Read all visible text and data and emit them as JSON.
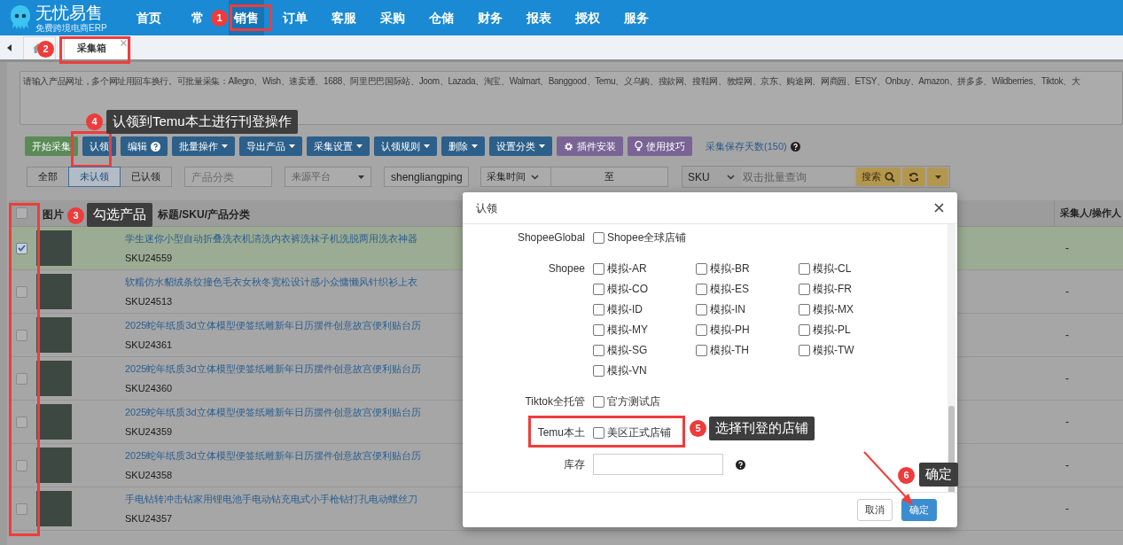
{
  "app": {
    "name": "无忧易售",
    "tagline": "免费跨境电商ERP"
  },
  "nav": [
    {
      "label": "首页",
      "selected": false
    },
    {
      "label": "常",
      "selected": false
    },
    {
      "label": "销售",
      "selected": true
    },
    {
      "label": "订单",
      "selected": false
    },
    {
      "label": "客服",
      "selected": false
    },
    {
      "label": "采购",
      "selected": false
    },
    {
      "label": "仓储",
      "selected": false
    },
    {
      "label": "财务",
      "selected": false
    },
    {
      "label": "报表",
      "selected": false
    },
    {
      "label": "授权",
      "selected": false
    },
    {
      "label": "服务",
      "selected": false
    }
  ],
  "tabs": [
    {
      "kind": "home",
      "selected": false
    },
    {
      "kind": "page",
      "label": "采集箱",
      "selected": true
    }
  ],
  "collect_input": {
    "placeholder": "请输入产品网址，多个网址用回车换行。可批量采集：Allegro、Wish、速卖通、1688、阿里巴巴国际站、Joom、Lazada、淘宝、Walmart、Banggood、Temu、义乌购、搜款网、搜鞋网、敦煌网、京东、购途网、网商园、ETSY、Onbuy、Amazon、拼多多、Wildberries、Tiktok、大"
  },
  "toolbar": [
    {
      "label": "开始采集",
      "kind": "success",
      "caret": false
    },
    {
      "label": "认领",
      "kind": "primary",
      "caret": false
    },
    {
      "label": "编辑",
      "kind": "help",
      "caret": false
    },
    {
      "label": "批量操作",
      "kind": "primary",
      "caret": true
    },
    {
      "label": "导出产品",
      "kind": "primary",
      "caret": true
    },
    {
      "label": "采集设置",
      "kind": "primary",
      "caret": true
    },
    {
      "label": "认领规则",
      "kind": "primary",
      "caret": true
    },
    {
      "label": "删除",
      "kind": "primary",
      "caret": true
    },
    {
      "label": "设置分类",
      "kind": "primary",
      "caret": true
    },
    {
      "label": "插件安装",
      "kind": "plugin",
      "caret": false
    },
    {
      "label": "使用技巧",
      "kind": "tips",
      "caret": false
    }
  ],
  "save_days": {
    "label": "采集保存天数(150)"
  },
  "filters": {
    "status_tabs": [
      {
        "label": "全部",
        "selected": false
      },
      {
        "label": "未认领",
        "selected": true
      },
      {
        "label": "已认领",
        "selected": false
      }
    ],
    "category": {
      "placeholder": "产品分类"
    },
    "source": {
      "placeholder": "来源平台"
    },
    "keyword": {
      "value": "shengliangping"
    },
    "time": {
      "value": "采集时间"
    },
    "range_separator": "至",
    "search_by": {
      "value": "SKU"
    },
    "search_input": {
      "placeholder": "双击批量查询"
    },
    "search_button": "搜索"
  },
  "table": {
    "select_all": {
      "checked": false
    },
    "columns": [
      "图片",
      "标题/SKU/产品分类",
      "采集人/操作人"
    ],
    "rows": [
      {
        "title": "学生迷你小型自动折叠洗衣机清洗内衣裤洗袜子机洗脱两用洗衣神器",
        "sku": "SKU24559",
        "collector": "-",
        "checked": true,
        "selected": true
      },
      {
        "title": "软糯仿水貂绒条纹撞色毛衣女秋冬宽松设计感小众慵懒风针织衫上衣",
        "sku": "SKU24513",
        "collector": "-",
        "checked": false,
        "selected": false
      },
      {
        "title": "2025蛇年纸质3d立体模型便签纸雕新年日历摆件创意故宫便利贴台历",
        "sku": "SKU24361",
        "collector": "-",
        "checked": false,
        "selected": false
      },
      {
        "title": "2025蛇年纸质3d立体模型便签纸雕新年日历摆件创意故宫便利贴台历",
        "sku": "SKU24360",
        "collector": "-",
        "checked": false,
        "selected": false
      },
      {
        "title": "2025蛇年纸质3d立体模型便签纸雕新年日历摆件创意故宫便利贴台历",
        "sku": "SKU24359",
        "collector": "-",
        "checked": false,
        "selected": false
      },
      {
        "title": "2025蛇年纸质3d立体模型便签纸雕新年日历摆件创意故宫便利贴台历",
        "sku": "SKU24358",
        "collector": "-",
        "checked": false,
        "selected": false
      },
      {
        "title": "手电钻转冲击钻家用锂电池手电动钻充电式小手枪钻打孔电动螺丝刀",
        "sku": "SKU24357",
        "collector": "-",
        "checked": false,
        "selected": false
      }
    ]
  },
  "dialog": {
    "title": "认领",
    "fields": [
      {
        "kind": "checks",
        "label": "ShopeeGlobal",
        "options": [
          {
            "label": "Shopee全球店铺",
            "checked": false
          }
        ]
      },
      {
        "kind": "checks",
        "label": "Shopee",
        "options": [
          {
            "label": "模拟-AR",
            "checked": false
          },
          {
            "label": "模拟-BR",
            "checked": false
          },
          {
            "label": "模拟-CL",
            "checked": false
          },
          {
            "label": "模拟-CO",
            "checked": false
          },
          {
            "label": "模拟-ES",
            "checked": false
          },
          {
            "label": "模拟-FR",
            "checked": false
          },
          {
            "label": "模拟-ID",
            "checked": false
          },
          {
            "label": "模拟-IN",
            "checked": false
          },
          {
            "label": "模拟-MX",
            "checked": false
          },
          {
            "label": "模拟-MY",
            "checked": false
          },
          {
            "label": "模拟-PH",
            "checked": false
          },
          {
            "label": "模拟-PL",
            "checked": false
          },
          {
            "label": "模拟-SG",
            "checked": false
          },
          {
            "label": "模拟-TH",
            "checked": false
          },
          {
            "label": "模拟-TW",
            "checked": false
          },
          {
            "label": "模拟-VN",
            "checked": false
          }
        ]
      },
      {
        "kind": "checks",
        "label": "Tiktok全托管",
        "options": [
          {
            "label": "官方测试店",
            "checked": false
          }
        ]
      },
      {
        "kind": "checks",
        "label": "Temu本土",
        "options": [
          {
            "label": "美区正式店铺",
            "checked": false
          }
        ]
      },
      {
        "kind": "input",
        "label": "库存"
      }
    ],
    "buttons": [
      {
        "label": "取消",
        "kind": "default"
      },
      {
        "label": "确定",
        "kind": "primary"
      }
    ]
  },
  "annotations": [
    {
      "number": "1"
    },
    {
      "number": "2"
    },
    {
      "number": "4",
      "text": "认领到Temu本土进行刊登操作"
    },
    {
      "number": "3",
      "text": "勾选产品"
    },
    {
      "number": "5",
      "text": "选择刊登的店铺"
    },
    {
      "number": "6",
      "text": "确定"
    }
  ]
}
